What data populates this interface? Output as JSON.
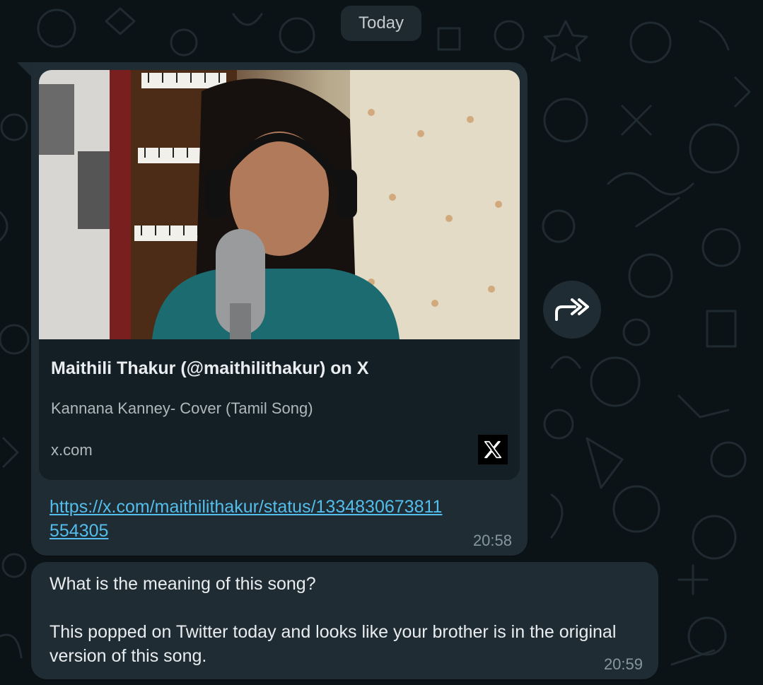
{
  "date_separator": "Today",
  "messages": [
    {
      "link_preview": {
        "title": "Maithili Thakur (@maithilithakur) on X",
        "description": "Kannana Kanney- Cover (Tamil Song)",
        "domain": "x.com",
        "site_icon": "x-logo-icon"
      },
      "link_text": "https://x.com/maithilithakur/status/1334830673811554305",
      "time": "20:58"
    },
    {
      "line1": "What is the meaning of this song?",
      "line2": "This popped on Twitter today and looks like your brother is in the original version of this song.",
      "time": "20:59"
    }
  ],
  "forward_button": {
    "icon": "forward-icon"
  },
  "colors": {
    "background": "#0c1317",
    "bubble": "#1f2c34",
    "link": "#53bdeb",
    "text": "#e9edef",
    "meta": "#8696a0"
  }
}
